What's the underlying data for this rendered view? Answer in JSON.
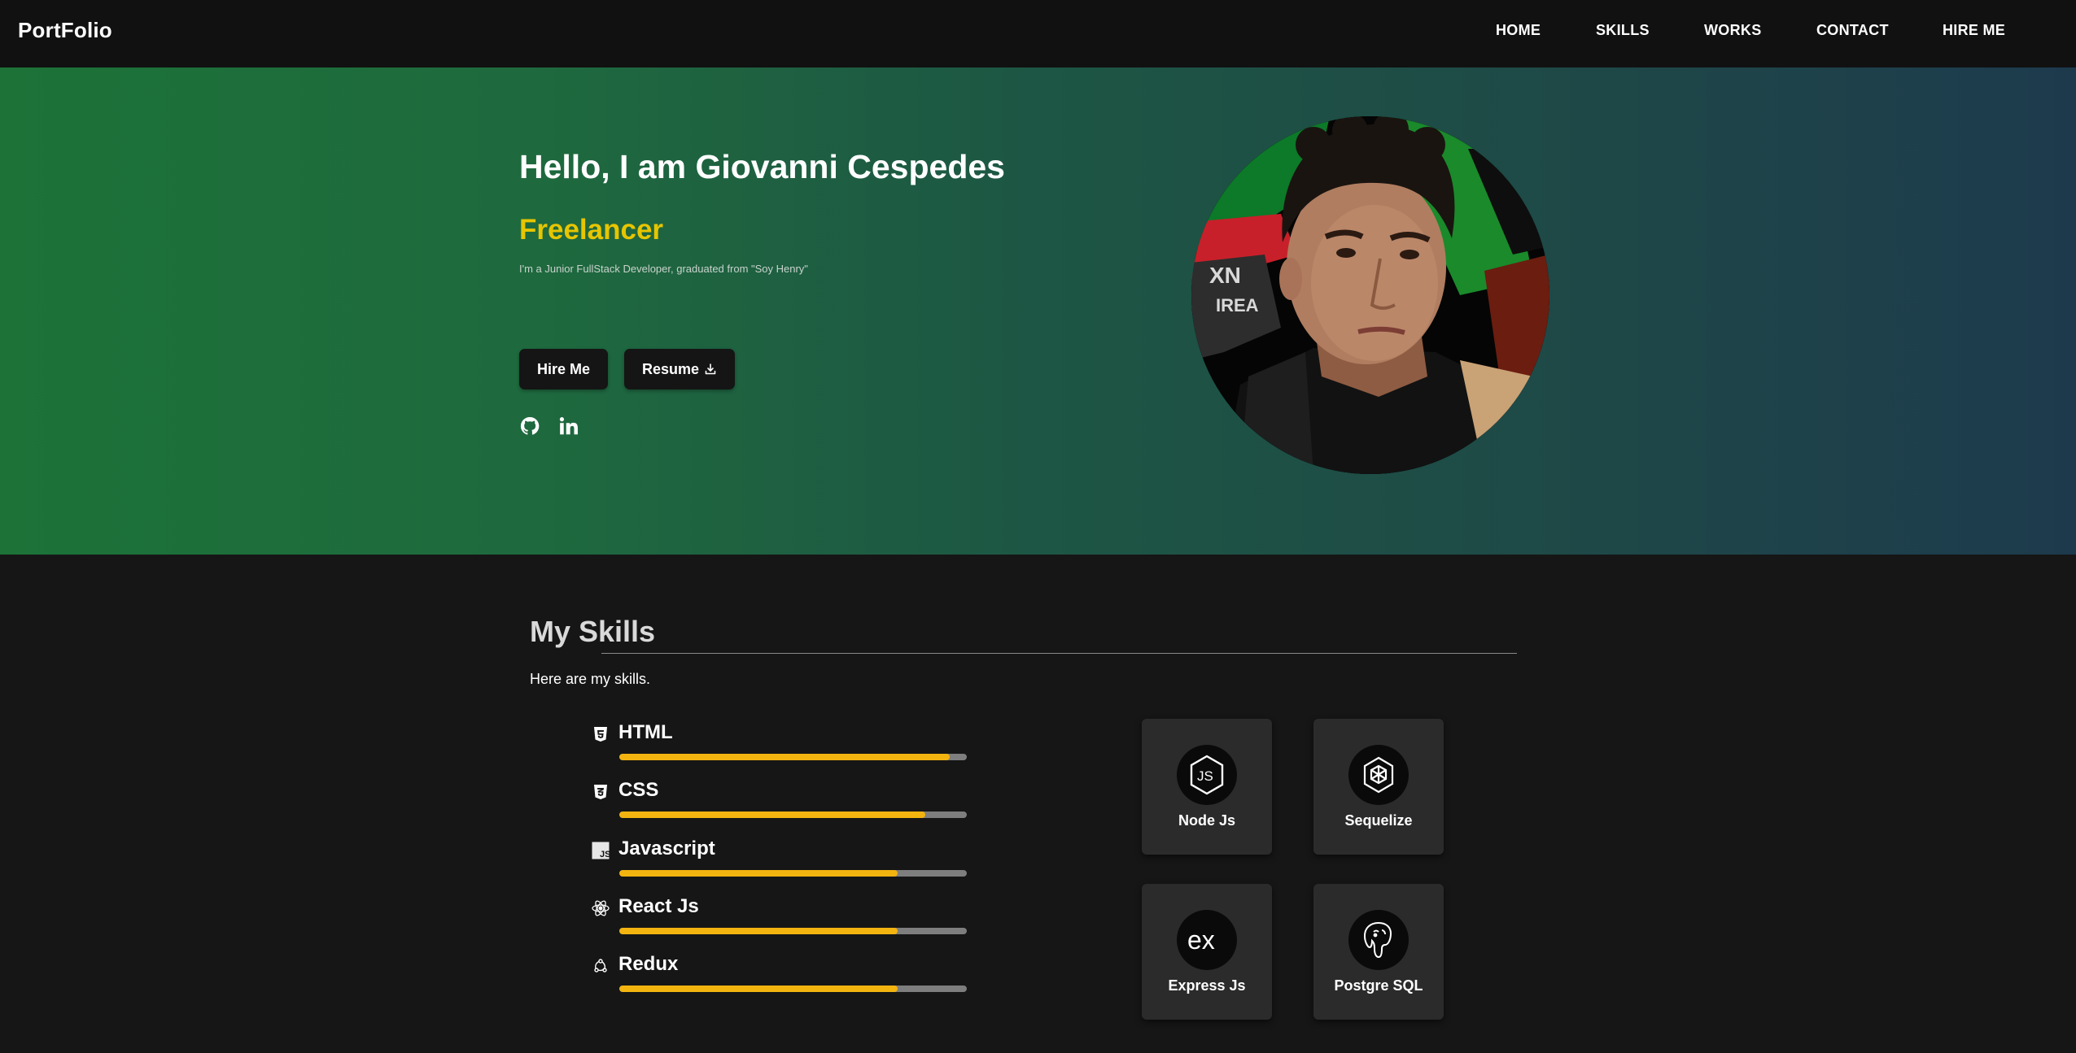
{
  "header": {
    "brand": "PortFolio",
    "nav": [
      "HOME",
      "SKILLS",
      "WORKS",
      "CONTACT",
      "HIRE ME"
    ]
  },
  "hero": {
    "title": "Hello, I am Giovanni Cespedes",
    "role": "Freelancer",
    "description": "I'm a Junior FullStack Developer, graduated from \"Soy Henry\"",
    "hire_button": "Hire Me",
    "resume_button": "Resume",
    "socials": [
      "github-icon",
      "linkedin-icon"
    ],
    "colors": {
      "role": "#e7c500",
      "gradient_start": "#1c7237",
      "gradient_end": "#1d3a4d"
    }
  },
  "skills": {
    "title": "My Skills",
    "subtitle": "Here are my skills.",
    "bars": [
      {
        "name": "HTML",
        "icon": "html5-icon",
        "level": 0.95
      },
      {
        "name": "CSS",
        "icon": "css3-icon",
        "level": 0.88
      },
      {
        "name": "Javascript",
        "icon": "javascript-icon",
        "level": 0.8
      },
      {
        "name": "React Js",
        "icon": "react-icon",
        "level": 0.8
      },
      {
        "name": "Redux",
        "icon": "redux-icon",
        "level": 0.8
      }
    ],
    "cards": [
      {
        "label": "Node Js",
        "icon": "nodejs-icon"
      },
      {
        "label": "Sequelize",
        "icon": "sequelize-icon"
      },
      {
        "label": "Express Js",
        "icon": "express-icon"
      },
      {
        "label": "Postgre SQL",
        "icon": "postgresql-icon"
      }
    ],
    "colors": {
      "bar_fill": "#f3b410",
      "bar_track": "#7e7e7e"
    }
  }
}
